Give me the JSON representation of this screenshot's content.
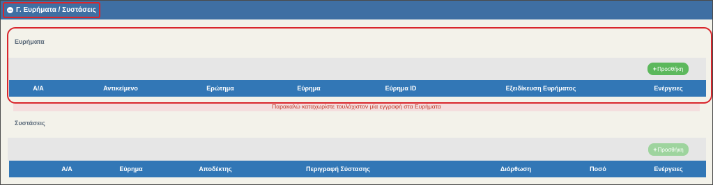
{
  "panel": {
    "title": "Γ. Ευρήματα / Συστάσεις"
  },
  "findings": {
    "label": "Ευρήματα",
    "add_label": "Προσθήκη",
    "columns": [
      "Α/Α",
      "Αντικείμενο",
      "Ερώτημα",
      "Εύρημα",
      "Εύρημα ID",
      "Εξειδίκευση Ευρήματος",
      "Ενέργειες"
    ],
    "error": "Παρακαλώ καταχωρίστε τουλάχιστον μία εγγραφή στα Ευρήματα"
  },
  "recommendations": {
    "label": "Συστάσεις",
    "add_label": "Προσθήκη",
    "columns": [
      "Α/Α",
      "Εύρημα",
      "Αποδέκτης",
      "Περιγραφή Σύστασης",
      "Διόρθωση",
      "Ποσό",
      "Ενέργειες"
    ]
  },
  "colors": {
    "header": "#3f6fa3",
    "table_head": "#3277b6",
    "highlight": "#d9262c",
    "add_button": "#5cb85c"
  }
}
